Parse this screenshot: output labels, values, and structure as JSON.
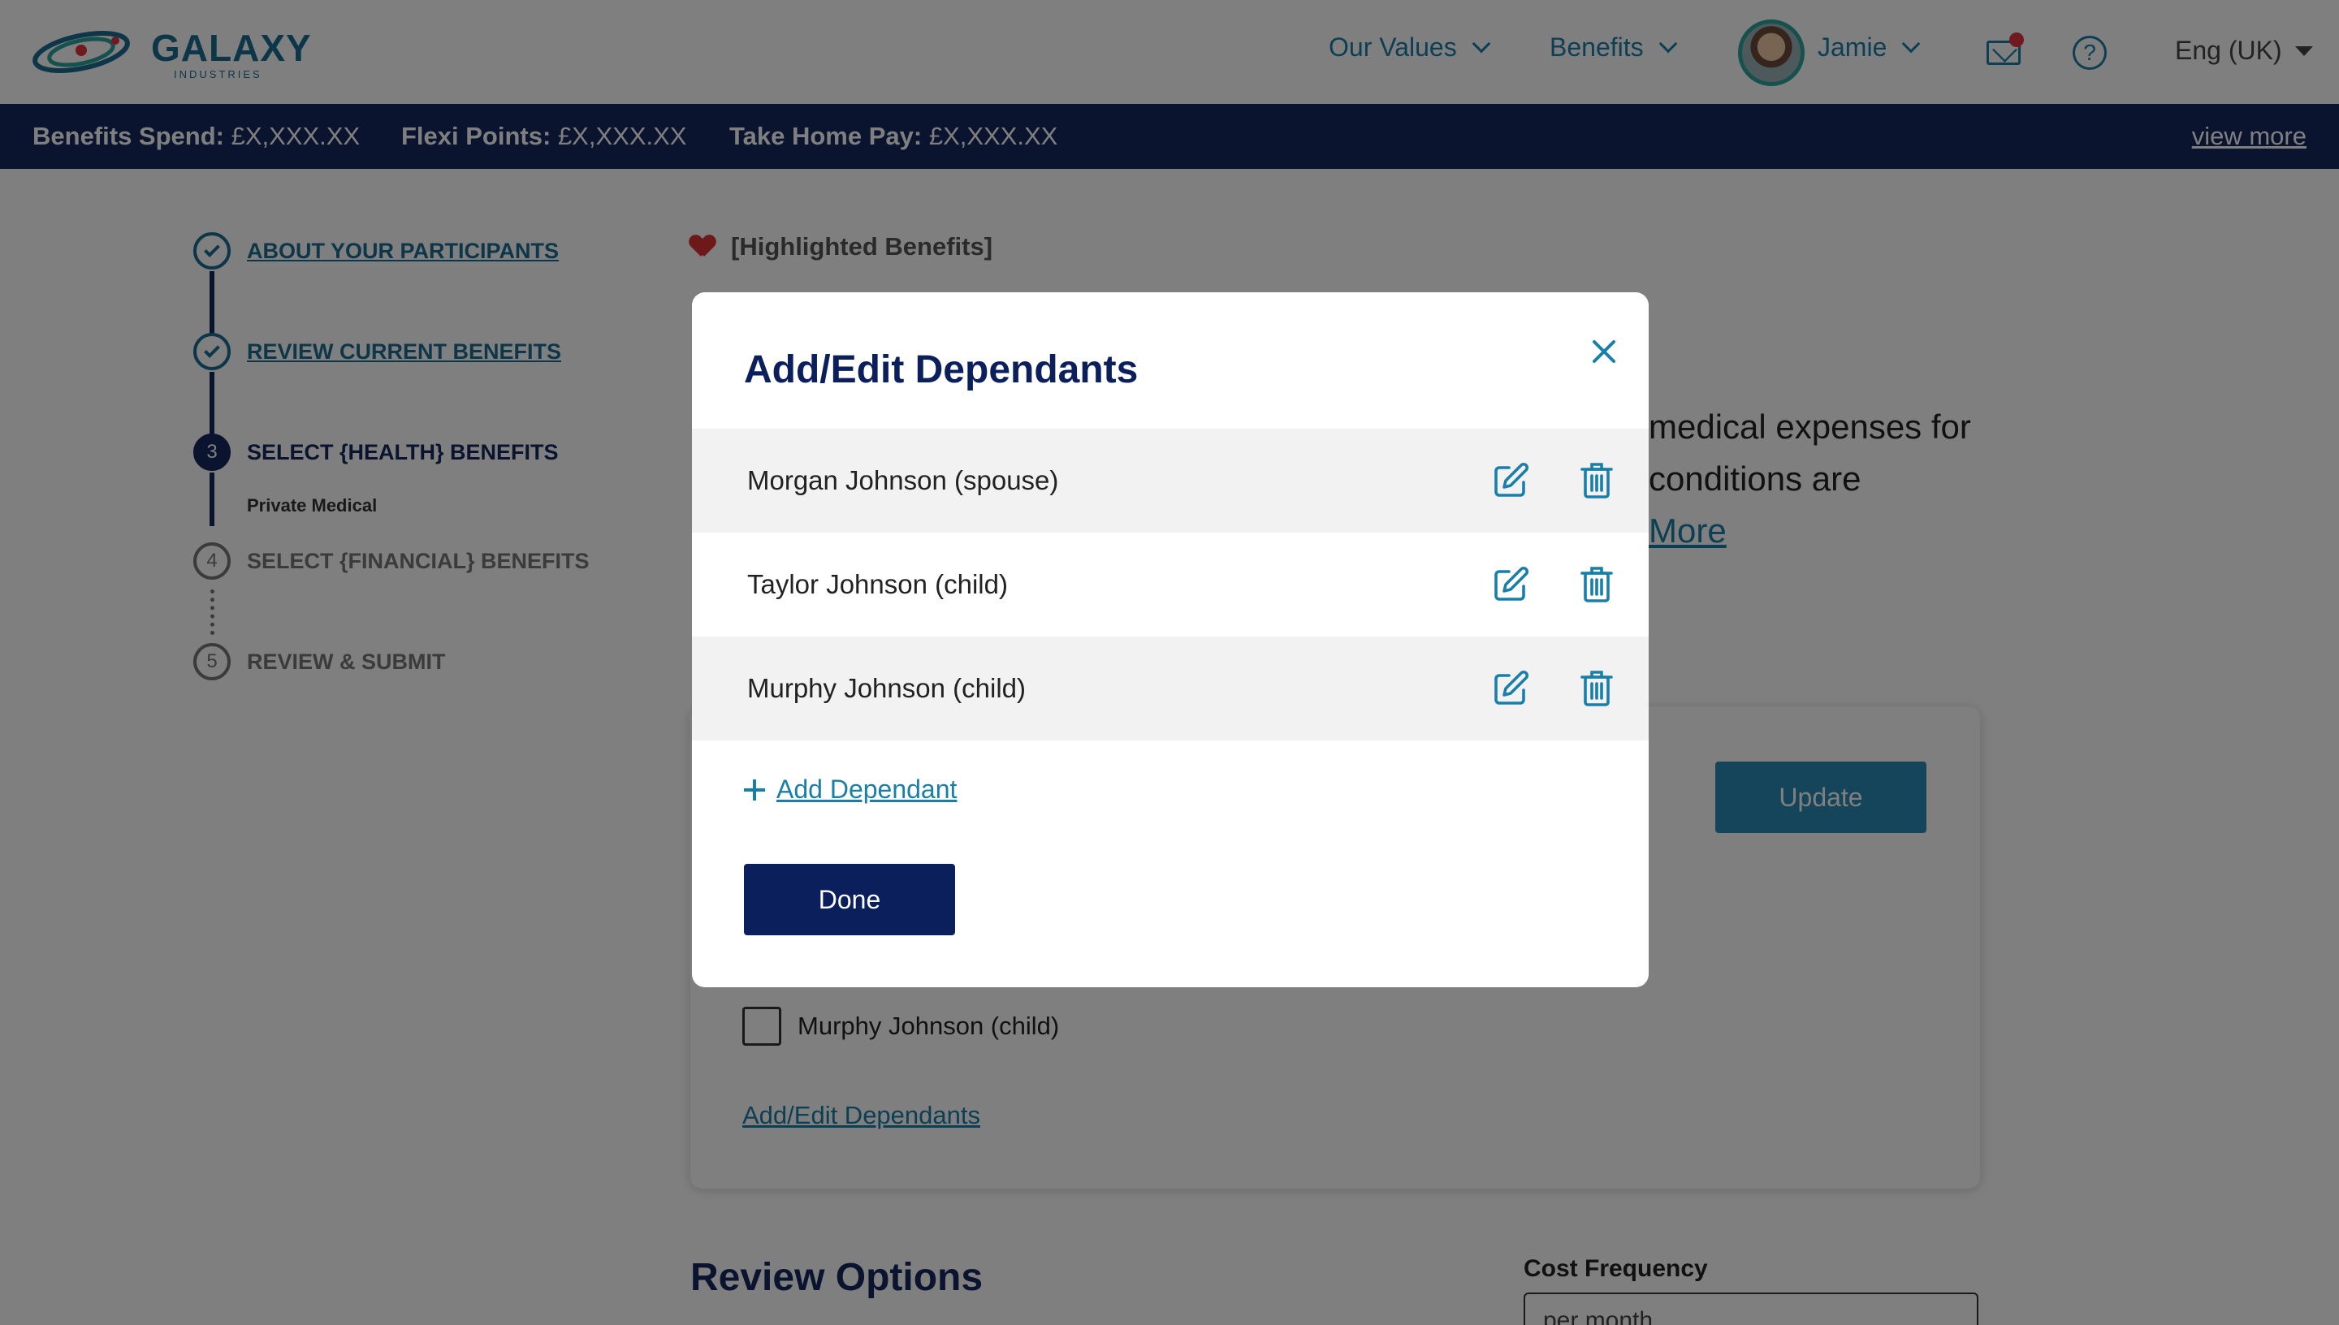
{
  "header": {
    "logo_text": "GALAXY",
    "logo_subtext": "INDUSTRIES",
    "nav": [
      {
        "label": "Our Values"
      },
      {
        "label": "Benefits"
      }
    ],
    "user_name": "Jamie",
    "language": "Eng (UK)",
    "icons": [
      "logo-icon",
      "mail-icon",
      "help-icon",
      "avatar"
    ]
  },
  "subbar": {
    "benefits_spend_label": "Benefits Spend:",
    "benefits_spend_value": "£X,XXX.XX",
    "flexi_points_label": "Flexi Points:",
    "flexi_points_value": "£X,XXX.XX",
    "take_home_label": "Take Home Pay:",
    "take_home_value": "£X,XXX.XX",
    "view_more": "view more"
  },
  "steps": [
    {
      "number": "",
      "label": "ABOUT YOUR PARTICIPANTS",
      "state": "complete"
    },
    {
      "number": "",
      "label": "REVIEW CURRENT BENEFITS",
      "state": "complete"
    },
    {
      "number": "3",
      "label": "SELECT {HEALTH} BENEFITS",
      "state": "current",
      "sub": "Private Medical"
    },
    {
      "number": "4",
      "label": "SELECT {FINANCIAL} BENEFITS",
      "state": "upcoming"
    },
    {
      "number": "5",
      "label": "REVIEW & SUBMIT",
      "state": "upcoming"
    }
  ],
  "main": {
    "highlight": "[Highlighted Benefits]",
    "partial_text_1": "medical expenses for",
    "partial_text_2": "conditions are",
    "partial_link": "More",
    "update_label": "Update",
    "checkbox_label": "Murphy Johnson (child)",
    "add_edit_link": "Add/Edit Dependants",
    "review_title": "Review Options",
    "cost_frequency_label": "Cost Frequency",
    "cost_frequency_value": "per month"
  },
  "modal": {
    "title": "Add/Edit Dependants",
    "dependants": [
      {
        "name": "Morgan Johnson (spouse)"
      },
      {
        "name": "Taylor Johnson (child)"
      },
      {
        "name": "Murphy Johnson (child)"
      }
    ],
    "add_label": "Add Dependant",
    "done_label": "Done"
  },
  "colors": {
    "navy": "#0b1f5c",
    "accent": "#1a7fa8",
    "teal": "#2aa59a",
    "alert": "#e0343f"
  }
}
